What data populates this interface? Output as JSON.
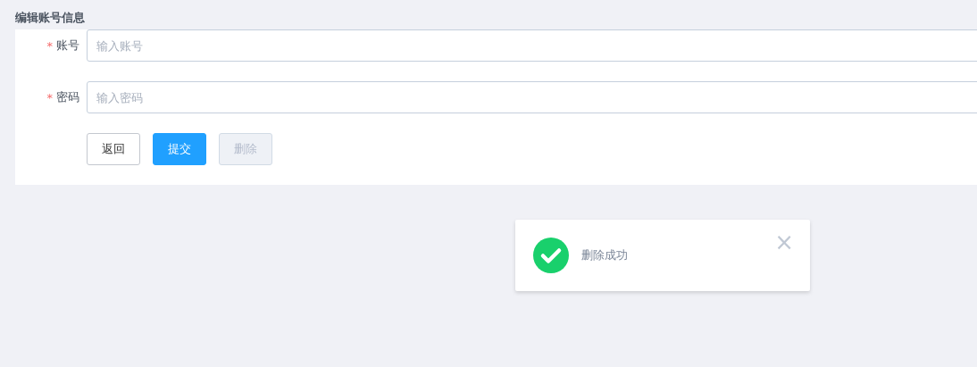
{
  "title": "编辑账号信息",
  "fields": [
    {
      "required_mark": "*",
      "label": "账号",
      "placeholder": "输入账号"
    },
    {
      "required_mark": "*",
      "label": "密码",
      "placeholder": "输入密码"
    }
  ],
  "buttons": [
    {
      "label": "返回",
      "kind": "default",
      "disabled": false
    },
    {
      "label": "提交",
      "kind": "primary",
      "disabled": false
    },
    {
      "label": "删除",
      "kind": "danger",
      "disabled": true
    }
  ],
  "toast": {
    "kind": "success",
    "message": "删除成功",
    "close": "×"
  }
}
